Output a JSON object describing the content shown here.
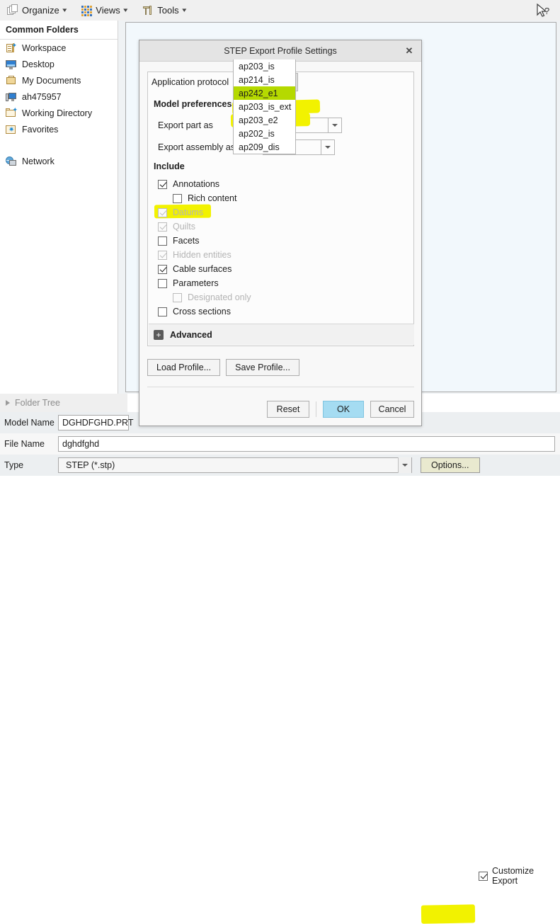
{
  "toolbar": {
    "items": [
      {
        "label": "Organize",
        "icon": "organize-icon"
      },
      {
        "label": "Views",
        "icon": "views-grid-icon"
      },
      {
        "label": "Tools",
        "icon": "tools-icon"
      }
    ]
  },
  "sidebar": {
    "header": "Common Folders",
    "items": [
      {
        "label": "Workspace",
        "icon": "workspace-icon"
      },
      {
        "label": "Desktop",
        "icon": "desktop-monitor-icon"
      },
      {
        "label": "My Documents",
        "icon": "documents-folder-icon"
      },
      {
        "label": "ah475957",
        "icon": "computer-icon"
      },
      {
        "label": "Working Directory",
        "icon": "working-directory-folder-icon"
      },
      {
        "label": "Favorites",
        "icon": "favorites-folder-icon"
      }
    ],
    "network_label": "Network",
    "folder_tree_label": "Folder Tree"
  },
  "dialog": {
    "title": "STEP Export Profile Settings",
    "close_glyph": "✕",
    "protocol": {
      "label": "Application protocol",
      "value": "ap242_e1",
      "options": [
        {
          "label": "ap203_is",
          "state": "normal"
        },
        {
          "label": "ap214_is",
          "state": "highlighted"
        },
        {
          "label": "ap242_e1",
          "state": "selected"
        },
        {
          "label": "ap203_is_ext",
          "state": "normal"
        },
        {
          "label": "ap203_e2",
          "state": "normal"
        },
        {
          "label": "ap202_is",
          "state": "normal"
        },
        {
          "label": "ap209_dis",
          "state": "normal"
        }
      ]
    },
    "model_preferences": {
      "title": "Model preferences",
      "rows": [
        {
          "label": "Export part as",
          "value": ""
        },
        {
          "label": "Export assembly as",
          "value": ""
        }
      ]
    },
    "include": {
      "title": "Include",
      "items": [
        {
          "label": "Annotations",
          "checked": true,
          "disabled": false,
          "indent": false,
          "highlight": false
        },
        {
          "label": "Rich content",
          "checked": false,
          "disabled": false,
          "indent": true,
          "highlight": false
        },
        {
          "label": "Datums",
          "checked": true,
          "disabled": true,
          "indent": false,
          "highlight": true
        },
        {
          "label": "Quilts",
          "checked": true,
          "disabled": true,
          "indent": false,
          "highlight": false
        },
        {
          "label": "Facets",
          "checked": false,
          "disabled": false,
          "indent": false,
          "highlight": false
        },
        {
          "label": "Hidden entities",
          "checked": true,
          "disabled": true,
          "indent": false,
          "highlight": false
        },
        {
          "label": "Cable surfaces",
          "checked": true,
          "disabled": false,
          "indent": false,
          "highlight": false
        },
        {
          "label": "Parameters",
          "checked": false,
          "disabled": false,
          "indent": false,
          "highlight": false
        },
        {
          "label": "Designated only",
          "checked": false,
          "disabled": true,
          "indent": true,
          "highlight": false
        },
        {
          "label": "Cross sections",
          "checked": false,
          "disabled": false,
          "indent": false,
          "highlight": false
        }
      ]
    },
    "advanced": {
      "label": "Advanced",
      "expander_glyph": "+"
    },
    "profile_buttons": [
      {
        "label": "Load Profile..."
      },
      {
        "label": "Save Profile..."
      }
    ],
    "action_buttons": {
      "reset": "Reset",
      "ok": "OK",
      "cancel": "Cancel"
    }
  },
  "bottom_form": {
    "model_name": {
      "label": "Model Name",
      "value": "DGHDFGHD.PRT"
    },
    "file_name": {
      "label": "File Name",
      "value": "dghdfghd"
    },
    "type": {
      "label": "Type",
      "value": "STEP (*.stp)"
    },
    "options_button": "Options...",
    "customize_export": {
      "label": "Customize Export",
      "checked": true
    }
  },
  "colors": {
    "highlight_yellow": "#f2f200",
    "selected_green": "#b5d900",
    "ok_blue": "#a5dcf2",
    "explorer_bg": "#f2f8fc",
    "toolbar_bg": "#f0f0f0"
  }
}
